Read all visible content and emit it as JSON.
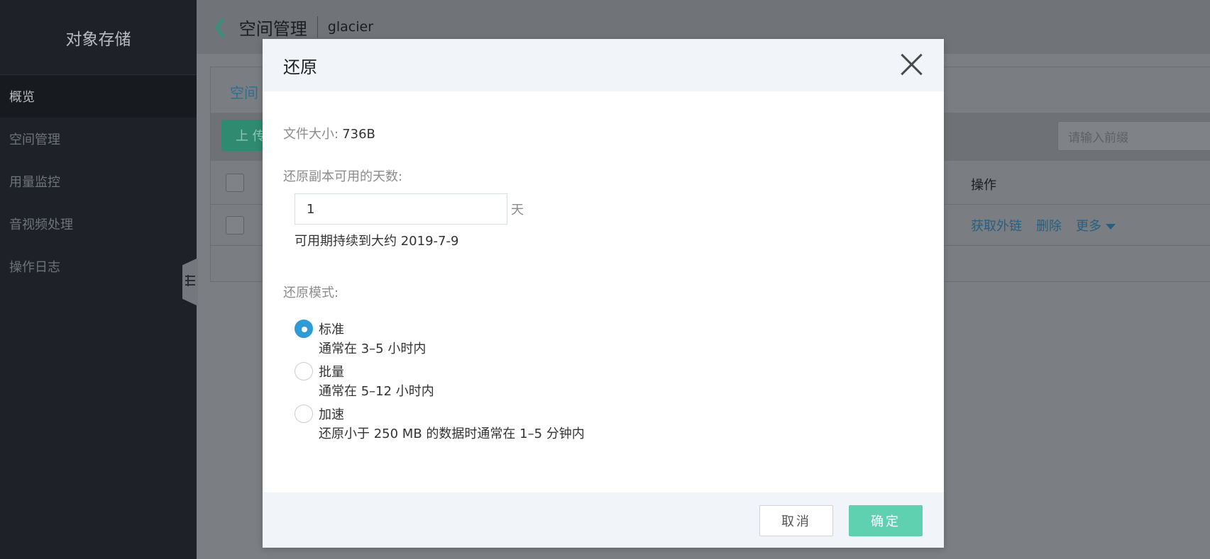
{
  "sidebar": {
    "brand": "对象存储",
    "items": [
      {
        "label": "概览",
        "active": true
      },
      {
        "label": "空间管理",
        "active": false
      },
      {
        "label": "用量监控",
        "active": false
      },
      {
        "label": "音视频处理",
        "active": false
      },
      {
        "label": "操作日志",
        "active": false
      }
    ]
  },
  "header": {
    "back_icon": "chevron-left-icon",
    "title": "空间管理",
    "bucket": "glacier"
  },
  "background_panel": {
    "tab_partial": "空间",
    "upload_partial": "上 传",
    "prefix_placeholder": "请输入前缀",
    "column_ops": "操作",
    "row_ops": [
      "获取外链",
      "删除",
      "更多"
    ]
  },
  "modal": {
    "title": "还原",
    "file_size_label": "文件大小:",
    "file_size_value": "736B",
    "days_label": "还原副本可用的天数:",
    "days_value": "1",
    "days_unit": "天",
    "availability": "可用期持续到大约 2019-7-9",
    "mode_label": "还原模式:",
    "modes": [
      {
        "name": "标准",
        "desc": "通常在 3–5 小时内",
        "checked": true
      },
      {
        "name": "批量",
        "desc": "通常在 5–12 小时内",
        "checked": false
      },
      {
        "name": "加速",
        "desc": "还原小于 250 MB 的数据时通常在 1–5 分钟内",
        "checked": false
      }
    ],
    "cancel_label": "取消",
    "ok_label": "确定"
  },
  "colors": {
    "accent": "#2f9bd6",
    "confirm": "#5fd1b1",
    "sidebar_bg": "#1e2127"
  }
}
